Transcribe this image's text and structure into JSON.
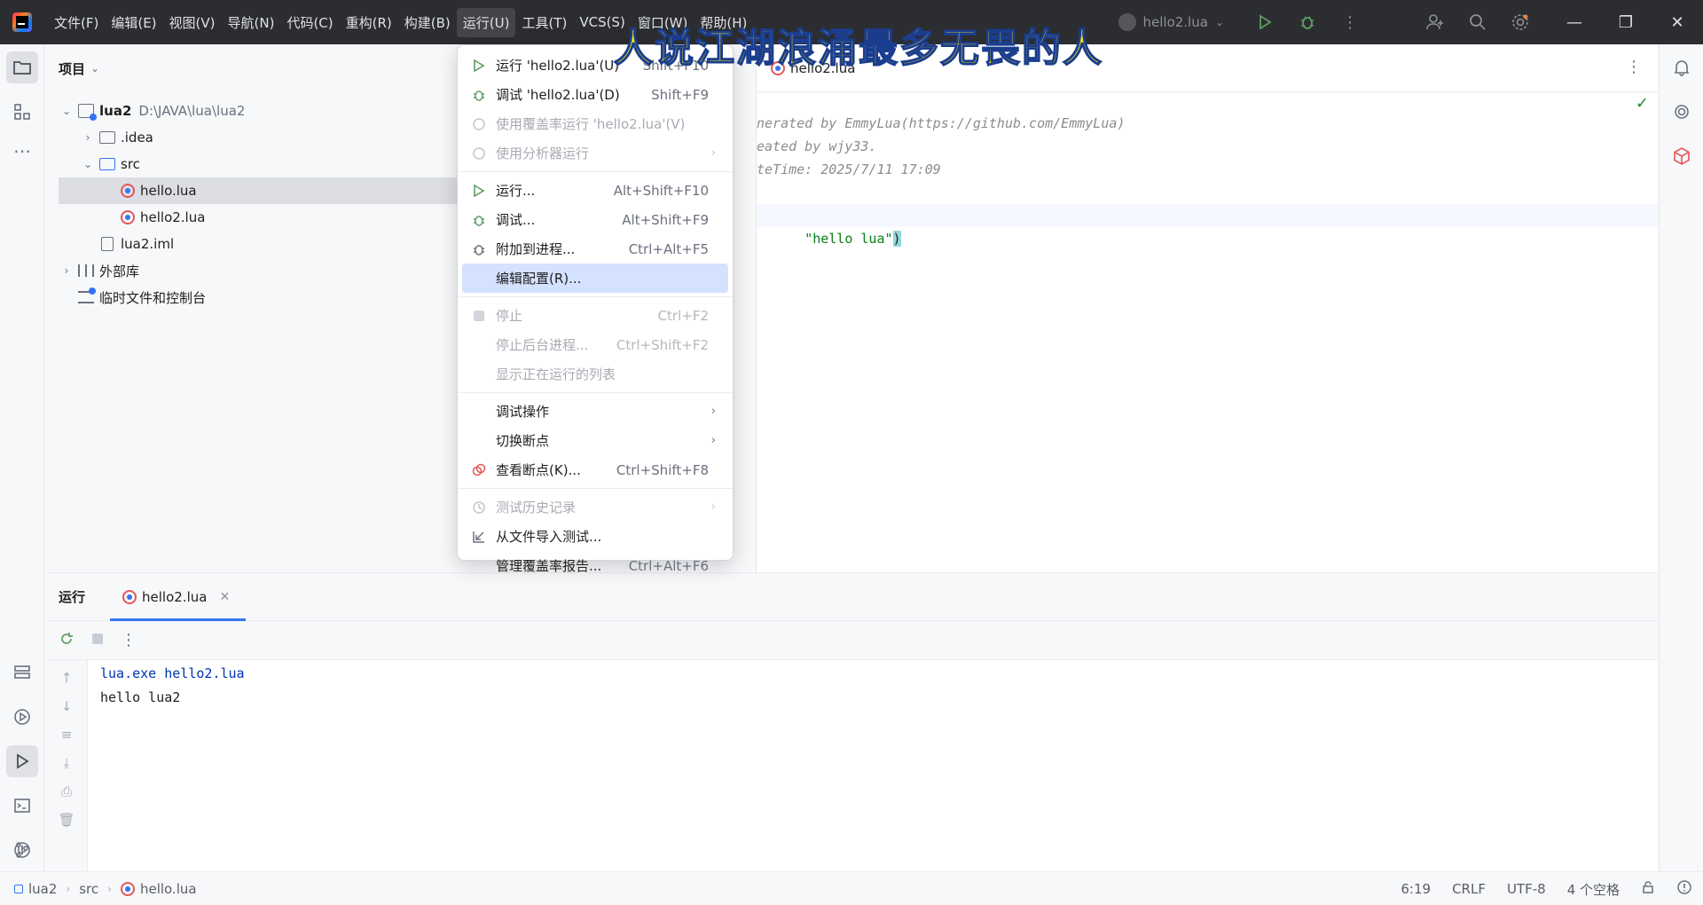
{
  "titlebar": {
    "menus": [
      "文件(F)",
      "编辑(E)",
      "视图(V)",
      "导航(N)",
      "代码(C)",
      "重构(R)",
      "构建(B)",
      "运行(U)",
      "工具(T)",
      "VCS(S)",
      "窗口(W)",
      "帮助(H)"
    ],
    "run_config": "hello2.lua",
    "colors": {
      "bg": "#2b2d30",
      "accent": "#3574f0"
    }
  },
  "subtitle": "人说江湖浪涌最多无畏的人",
  "project": {
    "title": "项目",
    "root": {
      "name": "lua2",
      "path": "D:\\JAVA\\lua\\lua2"
    },
    "idea": ".idea",
    "src": "src",
    "hello": "hello.lua",
    "hello2": "hello2.lua",
    "iml": "lua2.iml",
    "external": "外部库",
    "scratches": "临时文件和控制台"
  },
  "editor": {
    "tab": "hello2.lua",
    "comment1": "nerated by EmmyLua(https://github.com/EmmyLua)",
    "comment2": "eated by wjy33.",
    "comment3": "teTime: 2025/7/11 17:09",
    "code_str": "\"hello lua\"",
    "code_paren": ")"
  },
  "dropdown": {
    "items": [
      {
        "label": "运行 'hello2.lua'(U)",
        "shortcut": "Shift+F10"
      },
      {
        "label": "调试 'hello2.lua'(D)",
        "shortcut": "Shift+F9"
      },
      {
        "label": "使用覆盖率运行 'hello2.lua'(V)",
        "shortcut": ""
      },
      {
        "label": "使用分析器运行",
        "shortcut": ""
      },
      {
        "label": "运行...",
        "shortcut": "Alt+Shift+F10"
      },
      {
        "label": "调试...",
        "shortcut": "Alt+Shift+F9"
      },
      {
        "label": "附加到进程...",
        "shortcut": "Ctrl+Alt+F5"
      },
      {
        "label": "编辑配置(R)...",
        "shortcut": ""
      },
      {
        "label": "停止",
        "shortcut": "Ctrl+F2"
      },
      {
        "label": "停止后台进程...",
        "shortcut": "Ctrl+Shift+F2"
      },
      {
        "label": "显示正在运行的列表",
        "shortcut": ""
      },
      {
        "label": "调试操作",
        "shortcut": ""
      },
      {
        "label": "切换断点",
        "shortcut": ""
      },
      {
        "label": "查看断点(K)...",
        "shortcut": "Ctrl+Shift+F8"
      },
      {
        "label": "测试历史记录",
        "shortcut": ""
      },
      {
        "label": "从文件导入测试...",
        "shortcut": ""
      },
      {
        "label": "管理覆盖率报告...",
        "shortcut": "Ctrl+Alt+F6"
      }
    ]
  },
  "run": {
    "title": "运行",
    "tab": "hello2.lua",
    "console": [
      "lua.exe hello2.lua",
      "hello lua2"
    ]
  },
  "status": {
    "crumbs": [
      "lua2",
      "src",
      "hello.lua"
    ],
    "position": "6:19",
    "line_sep": "CRLF",
    "encoding": "UTF-8",
    "indent": "4 个空格"
  }
}
